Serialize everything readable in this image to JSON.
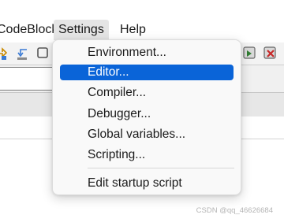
{
  "menubar": {
    "items": [
      {
        "label": "CodeBlocks"
      },
      {
        "label": "Settings"
      },
      {
        "label": "Help"
      }
    ]
  },
  "settings_menu": {
    "items": [
      {
        "label": "Environment..."
      },
      {
        "label": "Editor...",
        "selected": true
      },
      {
        "label": "Compiler..."
      },
      {
        "label": "Debugger..."
      },
      {
        "label": "Global variables..."
      },
      {
        "label": "Scripting..."
      },
      {
        "label": "Edit startup script"
      }
    ]
  },
  "toolbar": {
    "icons": [
      "step-into-icon",
      "step-out-icon",
      "debug-window-icon",
      "run-to-cursor-icon",
      "stop-debug-icon"
    ]
  },
  "watermark": "CSDN @qq_46626684",
  "colors": {
    "selection": "#0a64d8",
    "menu_background": "#f9f9f9",
    "menubar_hover": "#e5e5e5"
  }
}
